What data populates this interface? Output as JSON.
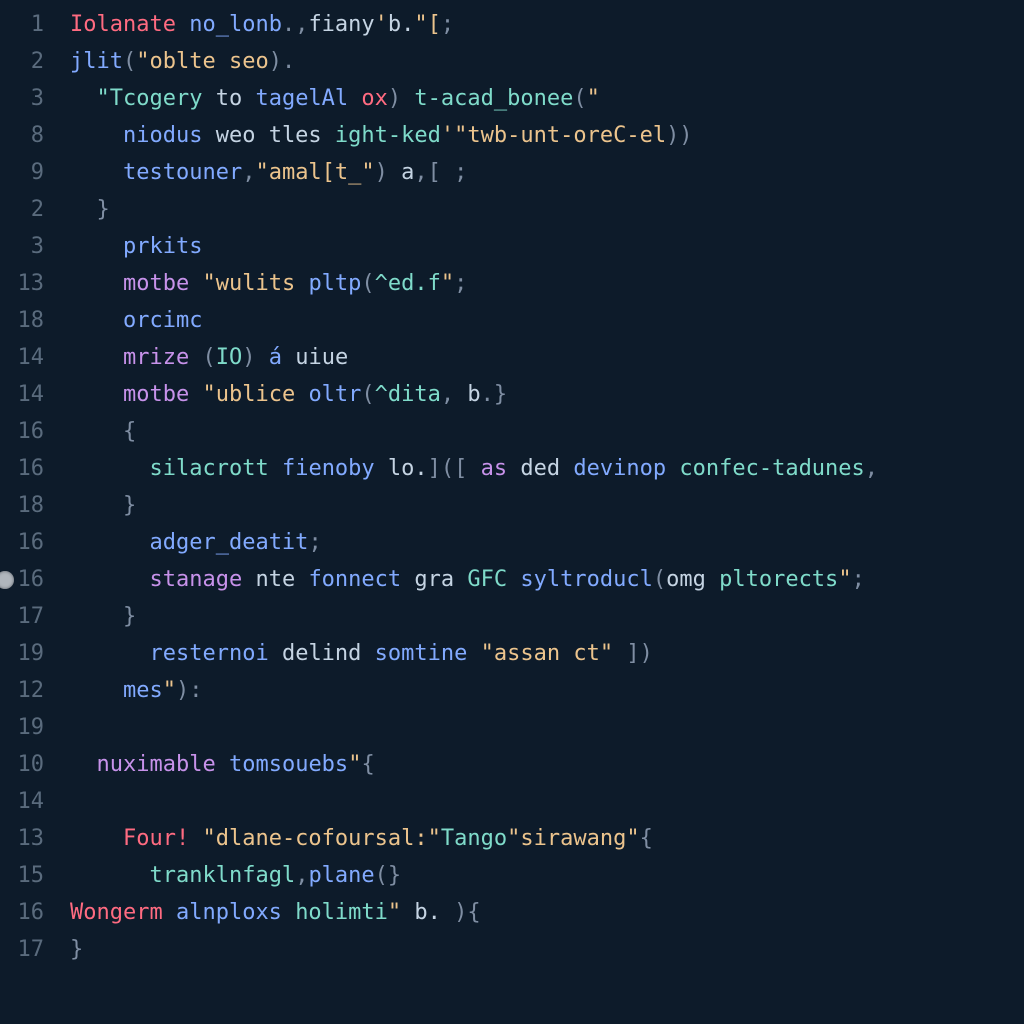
{
  "gutter": {
    "numbers": [
      "1",
      "2",
      "3",
      "8",
      "9",
      "2",
      "3",
      "13",
      "18",
      "14",
      "14",
      "16",
      "16",
      "18",
      "16",
      "16",
      "17",
      "19",
      "12",
      "19",
      "10",
      "14",
      "13",
      "15",
      "16",
      "17"
    ],
    "breakpoint_row_index": 15
  },
  "lines": [
    [
      {
        "t": "Iolanate",
        "c": "prop"
      },
      {
        "t": " ",
        "c": "id"
      },
      {
        "t": "no_lonb",
        "c": "fn"
      },
      {
        "t": ".,",
        "c": "pun"
      },
      {
        "t": "fiany",
        "c": "id"
      },
      {
        "t": "'",
        "c": "str"
      },
      {
        "t": "b.",
        "c": "id"
      },
      {
        "t": "\"[",
        "c": "str"
      },
      {
        "t": ";",
        "c": "pun"
      }
    ],
    [
      {
        "t": "jlit",
        "c": "fn"
      },
      {
        "t": "(",
        "c": "pun"
      },
      {
        "t": "\"oblte seo",
        "c": "str"
      },
      {
        "t": ")",
        "c": "pun"
      },
      {
        "t": ".",
        "c": "pun"
      }
    ],
    [
      {
        "t": "  ",
        "c": "id"
      },
      {
        "t": "\"Tcogery",
        "c": "type"
      },
      {
        "t": " to ",
        "c": "id"
      },
      {
        "t": "tagelAl",
        "c": "fn"
      },
      {
        "t": " ",
        "c": "id"
      },
      {
        "t": "ox",
        "c": "prop"
      },
      {
        "t": ")",
        "c": "pun"
      },
      {
        "t": " ",
        "c": "id"
      },
      {
        "t": "t-acad_bonee",
        "c": "type"
      },
      {
        "t": "(",
        "c": "pun"
      },
      {
        "t": "\"",
        "c": "str"
      }
    ],
    [
      {
        "t": "    ",
        "c": "id"
      },
      {
        "t": "niodus",
        "c": "fn"
      },
      {
        "t": " weo tles ",
        "c": "id"
      },
      {
        "t": "ight-ked",
        "c": "type"
      },
      {
        "t": "'",
        "c": "str"
      },
      {
        "t": "\"twb-unt-oreC-el",
        "c": "str"
      },
      {
        "t": "))",
        "c": "pun"
      }
    ],
    [
      {
        "t": "    ",
        "c": "id"
      },
      {
        "t": "testouner",
        "c": "fn"
      },
      {
        "t": ",",
        "c": "pun"
      },
      {
        "t": "\"amal[t_\"",
        "c": "str"
      },
      {
        "t": ") ",
        "c": "pun"
      },
      {
        "t": "a",
        "c": "id"
      },
      {
        "t": ",[ ;",
        "c": "pun"
      }
    ],
    [
      {
        "t": "  }",
        "c": "pun"
      }
    ],
    [
      {
        "t": "    ",
        "c": "id"
      },
      {
        "t": "prkits",
        "c": "fn"
      }
    ],
    [
      {
        "t": "    ",
        "c": "id"
      },
      {
        "t": "motbe",
        "c": "kw"
      },
      {
        "t": " ",
        "c": "id"
      },
      {
        "t": "\"wulits ",
        "c": "str"
      },
      {
        "t": "pltp",
        "c": "fn"
      },
      {
        "t": "(",
        "c": "pun"
      },
      {
        "t": "^ed.f",
        "c": "type"
      },
      {
        "t": "\"",
        "c": "str"
      },
      {
        "t": ";",
        "c": "pun"
      }
    ],
    [
      {
        "t": "    ",
        "c": "id"
      },
      {
        "t": "orcimc",
        "c": "fn"
      }
    ],
    [
      {
        "t": "    ",
        "c": "id"
      },
      {
        "t": "mrize",
        "c": "kw"
      },
      {
        "t": " (",
        "c": "pun"
      },
      {
        "t": "IO",
        "c": "type"
      },
      {
        "t": ") ",
        "c": "pun"
      },
      {
        "t": "á",
        "c": "fn"
      },
      {
        "t": " ",
        "c": "id"
      },
      {
        "t": "uiue",
        "c": "id"
      }
    ],
    [
      {
        "t": "    ",
        "c": "id"
      },
      {
        "t": "motbe",
        "c": "kw"
      },
      {
        "t": " ",
        "c": "id"
      },
      {
        "t": "\"ublice ",
        "c": "str"
      },
      {
        "t": "oltr",
        "c": "fn"
      },
      {
        "t": "(",
        "c": "pun"
      },
      {
        "t": "^dita",
        "c": "type"
      },
      {
        "t": ", ",
        "c": "pun"
      },
      {
        "t": "b",
        "c": "id"
      },
      {
        "t": ".}",
        "c": "pun"
      }
    ],
    [
      {
        "t": "    {",
        "c": "pun"
      }
    ],
    [
      {
        "t": "      ",
        "c": "id"
      },
      {
        "t": "silacrott",
        "c": "type"
      },
      {
        "t": " ",
        "c": "id"
      },
      {
        "t": "fienoby",
        "c": "fn"
      },
      {
        "t": " lo.",
        "c": "id"
      },
      {
        "t": "](",
        "c": "pun"
      },
      {
        "t": "[ ",
        "c": "pun"
      },
      {
        "t": "as",
        "c": "kw"
      },
      {
        "t": " ded ",
        "c": "id"
      },
      {
        "t": "devinop",
        "c": "fn"
      },
      {
        "t": " ",
        "c": "id"
      },
      {
        "t": "confec-tadunes",
        "c": "type"
      },
      {
        "t": ",",
        "c": "pun"
      }
    ],
    [
      {
        "t": "    }",
        "c": "pun"
      }
    ],
    [
      {
        "t": "      ",
        "c": "id"
      },
      {
        "t": "adger_deatit",
        "c": "fn"
      },
      {
        "t": ";",
        "c": "pun"
      }
    ],
    [
      {
        "t": "      ",
        "c": "id"
      },
      {
        "t": "stanage",
        "c": "kw"
      },
      {
        "t": " nte ",
        "c": "id"
      },
      {
        "t": "fonnect",
        "c": "fn"
      },
      {
        "t": " gra ",
        "c": "id"
      },
      {
        "t": "GFC",
        "c": "type"
      },
      {
        "t": " ",
        "c": "id"
      },
      {
        "t": "syltroducl",
        "c": "fn"
      },
      {
        "t": "(",
        "c": "pun"
      },
      {
        "t": "omg",
        "c": "id"
      },
      {
        "t": " ",
        "c": "id"
      },
      {
        "t": "pltorects",
        "c": "type"
      },
      {
        "t": "\"",
        "c": "str"
      },
      {
        "t": ";",
        "c": "pun"
      }
    ],
    [
      {
        "t": "    }",
        "c": "pun"
      }
    ],
    [
      {
        "t": "      ",
        "c": "id"
      },
      {
        "t": "resternoi",
        "c": "fn"
      },
      {
        "t": " delind ",
        "c": "id"
      },
      {
        "t": "somtine",
        "c": "fn"
      },
      {
        "t": " ",
        "c": "id"
      },
      {
        "t": "\"assan ct\"",
        "c": "str"
      },
      {
        "t": " ])",
        "c": "pun"
      }
    ],
    [
      {
        "t": "    ",
        "c": "id"
      },
      {
        "t": "mes",
        "c": "fn"
      },
      {
        "t": "\"",
        "c": "str"
      },
      {
        "t": "):",
        "c": "pun"
      }
    ],
    [
      {
        "t": "",
        "c": "id"
      }
    ],
    [
      {
        "t": "  ",
        "c": "id"
      },
      {
        "t": "nuximable",
        "c": "kw"
      },
      {
        "t": " ",
        "c": "id"
      },
      {
        "t": "tomsouebs",
        "c": "fn"
      },
      {
        "t": "\"",
        "c": "str"
      },
      {
        "t": "{",
        "c": "pun"
      }
    ],
    [
      {
        "t": "",
        "c": "id"
      }
    ],
    [
      {
        "t": "    ",
        "c": "id"
      },
      {
        "t": "Four!",
        "c": "prop"
      },
      {
        "t": " ",
        "c": "id"
      },
      {
        "t": "\"dlane-cofoursal:",
        "c": "str"
      },
      {
        "t": "\"",
        "c": "str"
      },
      {
        "t": "Tango",
        "c": "type"
      },
      {
        "t": "\"",
        "c": "str"
      },
      {
        "t": "sirawang",
        "c": "str"
      },
      {
        "t": "\"",
        "c": "str"
      },
      {
        "t": "{",
        "c": "pun"
      }
    ],
    [
      {
        "t": "      ",
        "c": "id"
      },
      {
        "t": "tranklnfagl",
        "c": "type"
      },
      {
        "t": ",",
        "c": "pun"
      },
      {
        "t": "plane",
        "c": "fn"
      },
      {
        "t": "(}",
        "c": "pun"
      }
    ],
    [
      {
        "t": "",
        "c": "id"
      },
      {
        "t": "Wongerm",
        "c": "prop"
      },
      {
        "t": " ",
        "c": "id"
      },
      {
        "t": "alnploxs",
        "c": "fn"
      },
      {
        "t": " ",
        "c": "id"
      },
      {
        "t": "holimti",
        "c": "type"
      },
      {
        "t": "\"",
        "c": "str"
      },
      {
        "t": " b. ",
        "c": "id"
      },
      {
        "t": "){",
        "c": "pun"
      }
    ],
    [
      {
        "t": "}",
        "c": "pun"
      }
    ]
  ]
}
